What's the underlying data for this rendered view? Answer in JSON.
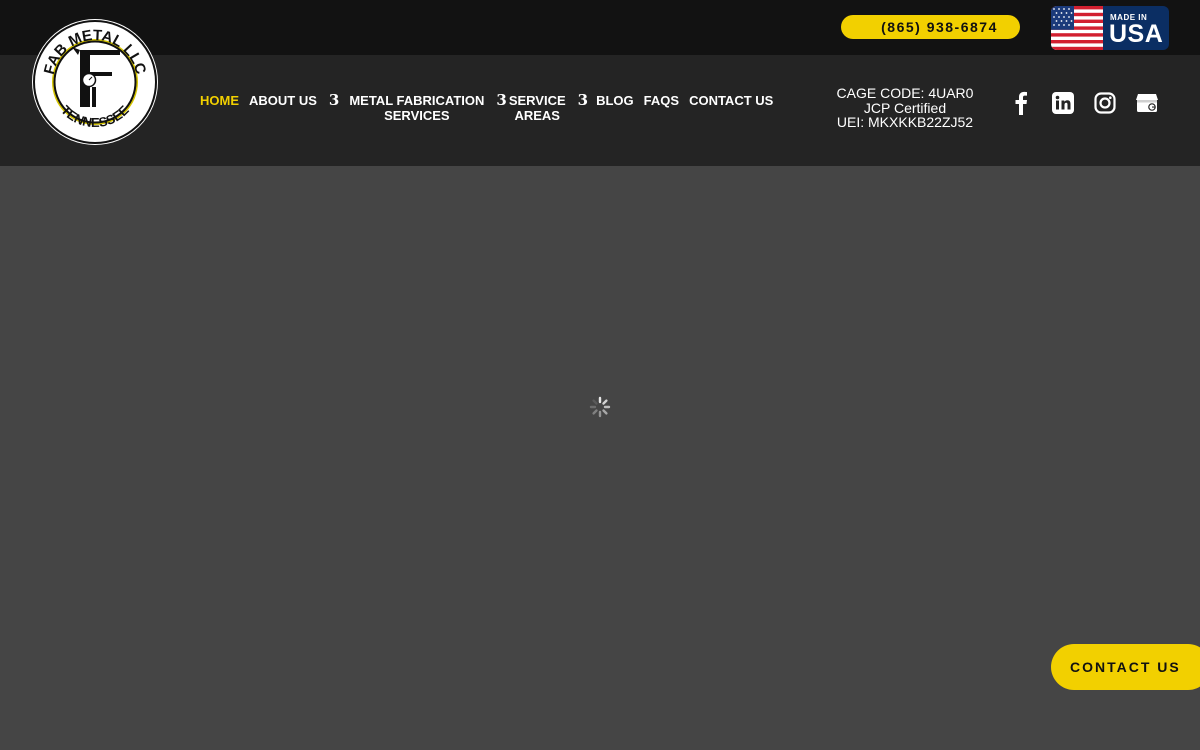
{
  "topbar": {
    "phone": "(865) 938-6874",
    "badge_small": "MADE IN",
    "badge_large": "USA"
  },
  "logo": {
    "top_text": "FAB METAL LLC",
    "bottom_text": "TENNESSEE",
    "letter": "F"
  },
  "nav": {
    "items": [
      {
        "label": "HOME",
        "active": true
      },
      {
        "label": "ABOUT US",
        "has_submenu": true
      },
      {
        "label": "METAL FABRICATION SERVICES",
        "line1": "METAL FABRICATION",
        "line2": "SERVICES",
        "has_submenu": true
      },
      {
        "label": "SERVICE AREAS",
        "line1": "SERVICE",
        "line2": "AREAS",
        "has_submenu": true
      },
      {
        "label": "BLOG"
      },
      {
        "label": "FAQS"
      },
      {
        "label": "CONTACT US"
      }
    ],
    "submenu_glyph": "3"
  },
  "credentials": {
    "cage": "CAGE CODE: 4UAR0",
    "jcp": "JCP Certified",
    "uei": "UEI: MKXKKB22ZJ52"
  },
  "social": [
    "facebook-icon",
    "linkedin-icon",
    "instagram-icon",
    "google-business-icon"
  ],
  "floating_button": {
    "label": "CONTACT US"
  },
  "colors": {
    "accent": "#f2d000",
    "topbar": "#121212",
    "header": "#242424",
    "content": "#454545"
  }
}
